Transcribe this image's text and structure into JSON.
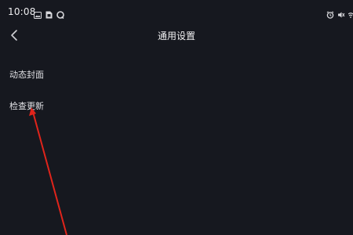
{
  "status_bar": {
    "time": "10:08",
    "left_icons": [
      "image-icon",
      "sim-card-icon",
      "chat-bubble-icon"
    ],
    "right_icons": [
      "alarm-icon",
      "mute-icon",
      "wifi-icon"
    ]
  },
  "nav": {
    "title": "通用设置",
    "back_icon": "chevron-left-icon"
  },
  "settings": {
    "items": [
      {
        "label": "动态封面"
      },
      {
        "label": "检查更新"
      }
    ]
  },
  "annotation": {
    "color": "#e0241b"
  }
}
